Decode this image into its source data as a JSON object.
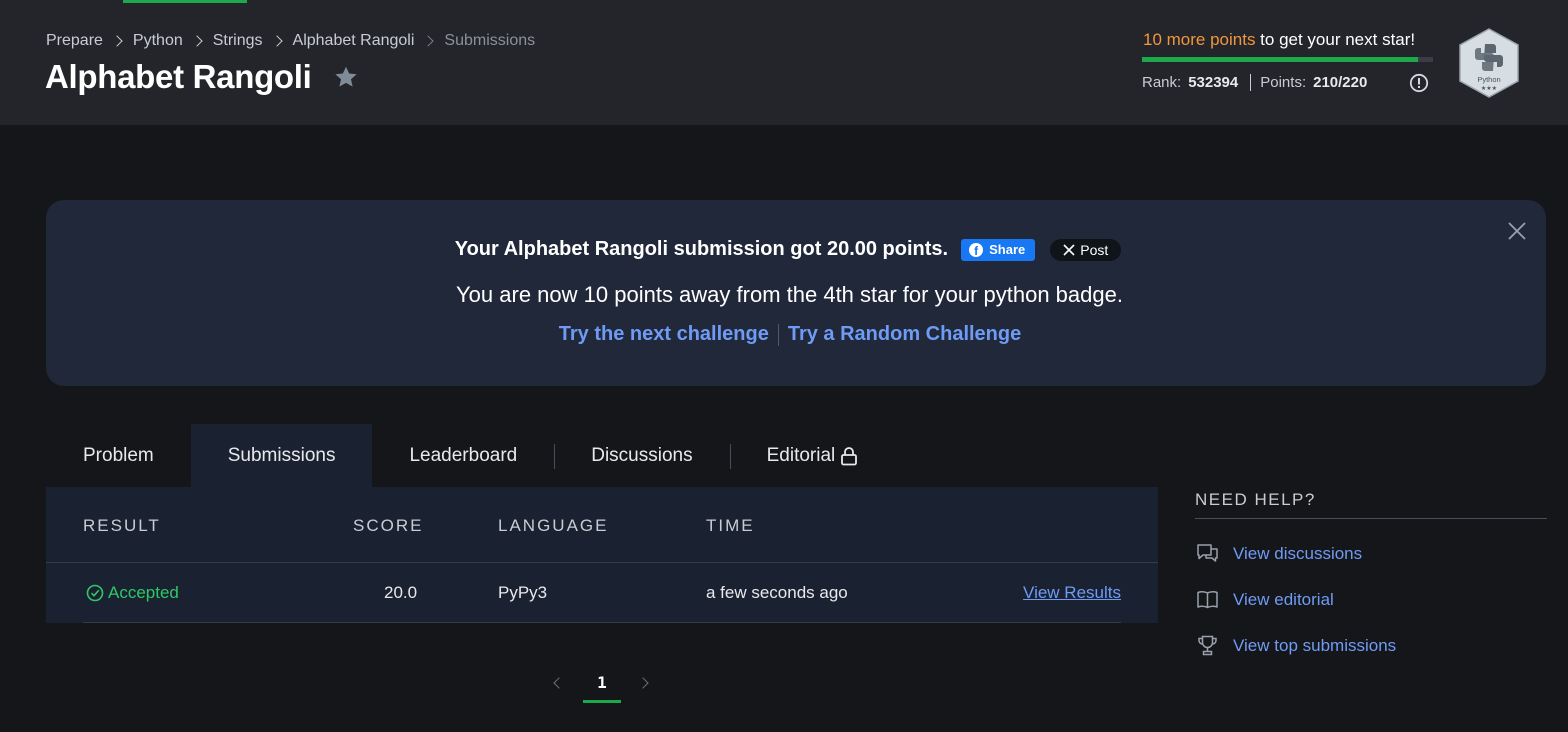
{
  "header": {
    "breadcrumbs": [
      "Prepare",
      "Python",
      "Strings",
      "Alphabet Rangoli",
      "Submissions"
    ],
    "title": "Alphabet Rangoli",
    "progress": {
      "highlight": "10 more points",
      "rest": " to get your next star!",
      "fraction": 0.95
    },
    "rank_label": "Rank:",
    "rank_value": "532394",
    "points_label": "Points:",
    "points_value": "210/220",
    "badge": {
      "label": "Python",
      "stars": "★★★"
    }
  },
  "banner": {
    "headline": "Your Alphabet Rangoli submission got 20.00 points.",
    "share_label": "Share",
    "post_label": "Post",
    "subtext": "You are now 10 points away from the 4th star for your python badge.",
    "link_next": "Try the next challenge",
    "link_random": "Try a Random Challenge"
  },
  "tabs": [
    {
      "label": "Problem"
    },
    {
      "label": "Submissions"
    },
    {
      "label": "Leaderboard"
    },
    {
      "label": "Discussions"
    },
    {
      "label": "Editorial"
    }
  ],
  "table": {
    "columns": [
      "RESULT",
      "SCORE",
      "LANGUAGE",
      "TIME"
    ],
    "rows": [
      {
        "result": "Accepted",
        "score": "20.0",
        "language": "PyPy3",
        "time": "a few seconds ago",
        "action": "View Results"
      }
    ]
  },
  "pagination": {
    "current": "1"
  },
  "help": {
    "title": "NEED HELP?",
    "items": [
      {
        "label": "View discussions",
        "icon": "discussions-icon"
      },
      {
        "label": "View editorial",
        "icon": "book-icon"
      },
      {
        "label": "View top submissions",
        "icon": "trophy-icon"
      }
    ]
  },
  "colors": {
    "accent_green": "#1ba94c",
    "link_blue": "#6f9bf5",
    "highlight_orange": "#f0963c"
  }
}
